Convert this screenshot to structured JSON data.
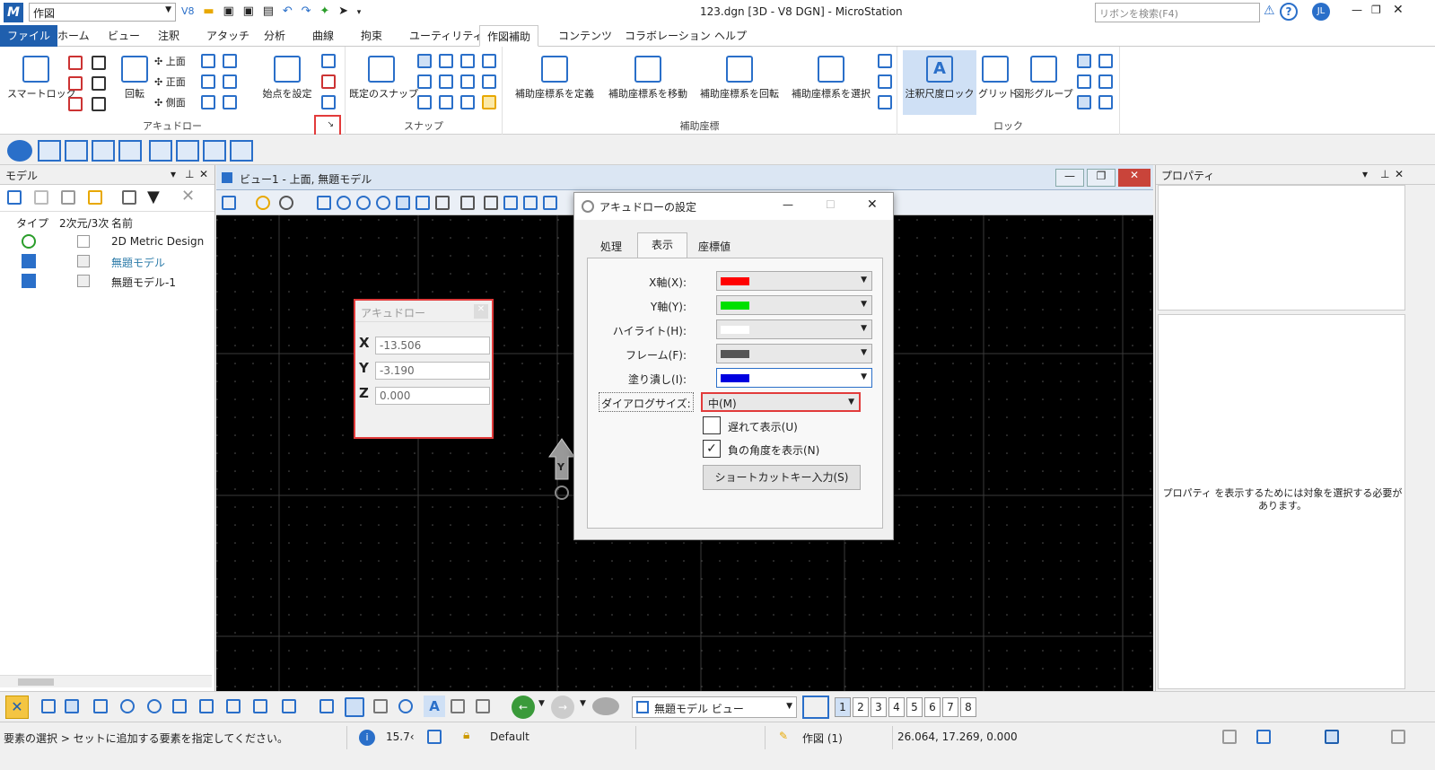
{
  "app": {
    "workflow": "作図",
    "window_title": "123.dgn [3D - V8 DGN] - MicroStation",
    "search_placeholder": "リボンを検索(F4)",
    "user_initials": "JL",
    "v8_label": "V8"
  },
  "tabs": [
    "ファイル",
    "ホーム",
    "ビュー",
    "注釈",
    "アタッチ",
    "分析",
    "曲線",
    "拘束",
    "ユーティリティ",
    "作図補助",
    "コンテンツ",
    "コラボレーション",
    "ヘルプ"
  ],
  "ribbon": {
    "accudraw": {
      "label": "アキュドロー",
      "smartlock": "スマートロック",
      "rotate": "回転",
      "top": "上面",
      "front": "正面",
      "side": "側面",
      "set_origin": "始点を設定"
    },
    "snaps": {
      "label": "スナップ",
      "default_snap": "既定のスナップ"
    },
    "acs": {
      "label": "補助座標",
      "define": "補助座標系を定義",
      "move": "補助座標系を移動",
      "rotate": "補助座標系を回転",
      "select": "補助座標系を選択"
    },
    "locks": {
      "label": "ロック",
      "annotation_scale": "注釈尺度ロック",
      "grid": "グリッド",
      "graphic_group": "図形グループ"
    }
  },
  "models_panel": {
    "title": "モデル",
    "columns": [
      "タイプ",
      "2次元/3次",
      "名前"
    ],
    "rows": [
      {
        "name": "2D Metric Design"
      },
      {
        "name": "無題モデル",
        "active": true
      },
      {
        "name": "無題モデル-1"
      }
    ]
  },
  "view": {
    "title": "ビュー1 - 上面, 無題モデル",
    "y_axis": "Y"
  },
  "accudraw_window": {
    "title": "アキュドロー",
    "x": "-13.506",
    "y": "-3.190",
    "z": "0.000",
    "x_label": "X",
    "y_label": "Y",
    "z_label": "Z"
  },
  "dialog": {
    "title": "アキュドローの設定",
    "tabs": [
      "処理",
      "表示",
      "座標値"
    ],
    "rows": [
      {
        "label": "X軸(X):",
        "color": "#ff0000"
      },
      {
        "label": "Y軸(Y):",
        "color": "#00e000"
      },
      {
        "label": "ハイライト(H):",
        "color": "#ffffff"
      },
      {
        "label": "フレーム(F):",
        "color": "#555555"
      },
      {
        "label": "塗り潰し(I):",
        "color": "#0000e0"
      }
    ],
    "size_label": "ダイアログサイズ:",
    "size_value": "中(M)",
    "delayed": "遅れて表示(U)",
    "negative_angle": "負の角度を表示(N)",
    "shortcut": "ショートカットキー入力(S)"
  },
  "properties": {
    "title": "プロパティ",
    "message": "プロパティ を表示するためには対象を選択する必要があります。"
  },
  "bottom_toolbar": {
    "view_combo": "無題モデル ビュー",
    "views": [
      "1",
      "2",
      "3",
      "4",
      "5",
      "6",
      "7",
      "8"
    ]
  },
  "status": {
    "prompt": "要素の選択 > セットに追加する要素を指定してください。",
    "value": "15.7‹",
    "level": "Default",
    "mode": "作図 (1)",
    "coords": "26.064, 17.269, 0.000"
  }
}
